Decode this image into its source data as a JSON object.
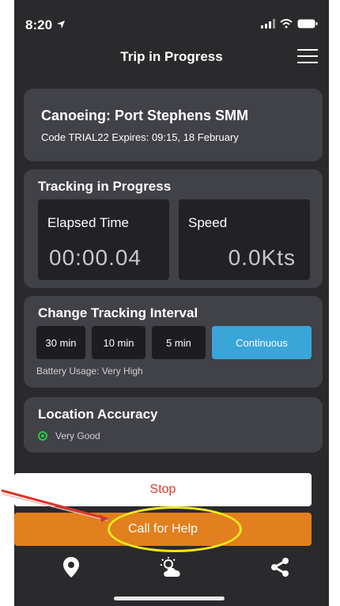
{
  "status": {
    "time": "8:20"
  },
  "header": {
    "title": "Trip in Progress"
  },
  "trip": {
    "title": "Canoeing: Port Stephens SMM",
    "code_line": "Code TRIAL22 Expires: 09:15, 18 February"
  },
  "tracking": {
    "title": "Tracking in Progress",
    "elapsed_label": "Elapsed Time",
    "elapsed_value": "00:00.04",
    "speed_label": "Speed",
    "speed_value": "0.0Kts"
  },
  "interval": {
    "title": "Change Tracking Interval",
    "options": [
      "30 min",
      "10 min",
      "5 min",
      "Continuous"
    ],
    "selected": "Continuous",
    "battery_note": "Battery Usage: Very High"
  },
  "accuracy": {
    "title": "Location Accuracy",
    "value": "Very Good"
  },
  "actions": {
    "stop_label": "Stop",
    "help_label": "Call for Help"
  },
  "tabs": [
    "location-pin-icon",
    "weather-icon",
    "share-icon"
  ],
  "colors": {
    "background": "#2a2a2d",
    "card": "#414148",
    "active_interval": "#3aa5d8",
    "stop_text": "#e0362c",
    "help_button": "#e27f1e",
    "accuracy_indicator": "#2ec843",
    "annotation_ellipse": "#f0ea1f",
    "annotation_arrow": "#d9342a"
  }
}
